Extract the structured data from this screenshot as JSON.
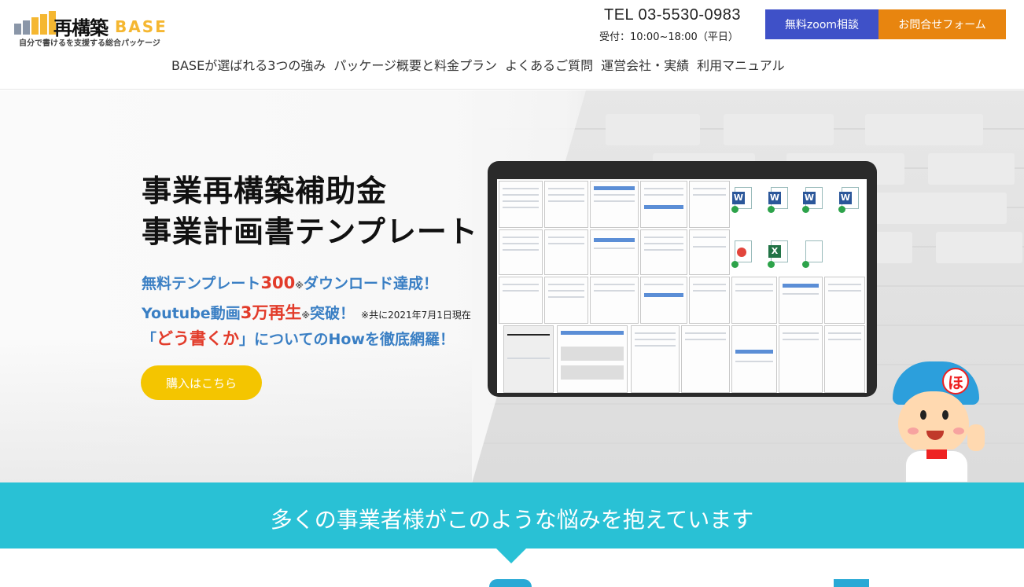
{
  "header": {
    "logo_main": "再構築",
    "logo_base": "BASE",
    "logo_tagline": "自分で書けるを支援する総合パッケージ",
    "tel": "TEL 03-5530-0983",
    "hours": "受付：10:00~18:00（平日）",
    "zoom_button": "無料zoom相談",
    "contact_button": "お問合せフォーム"
  },
  "nav": {
    "items": [
      "BASEが選ばれる3つの強み",
      "パッケージ概要と料金プラン",
      "よくあるご質問",
      "運営会社・実績",
      "利用マニュアル"
    ]
  },
  "hero": {
    "title_line1": "事業再構築補助金",
    "title_line2": "事業計画書テンプレート",
    "line1_a": "無料テンプレート",
    "line1_num": "300",
    "line1_mark": "※",
    "line1_b": "ダウンロード達成！",
    "line2_a": "Youtube動画",
    "line2_num": "3万再生",
    "line2_mark": "※",
    "line2_b": "突破！",
    "line2_note": "※共に2021年7月1日現在",
    "line3_a": "「",
    "line3_red": "どう書くか",
    "line3_b": "」についてのHowを徹底網羅！",
    "buy_button": "購入はこちら"
  },
  "banner": {
    "text": "多くの事業者様がこのような悩みを抱えています"
  },
  "colors": {
    "zoom_button": "#3f51c8",
    "contact_button": "#e8850f",
    "buy_button": "#f4c500",
    "banner": "#29c1d5",
    "highlight_blue": "#3a7fc4",
    "highlight_red": "#e23b2a"
  }
}
